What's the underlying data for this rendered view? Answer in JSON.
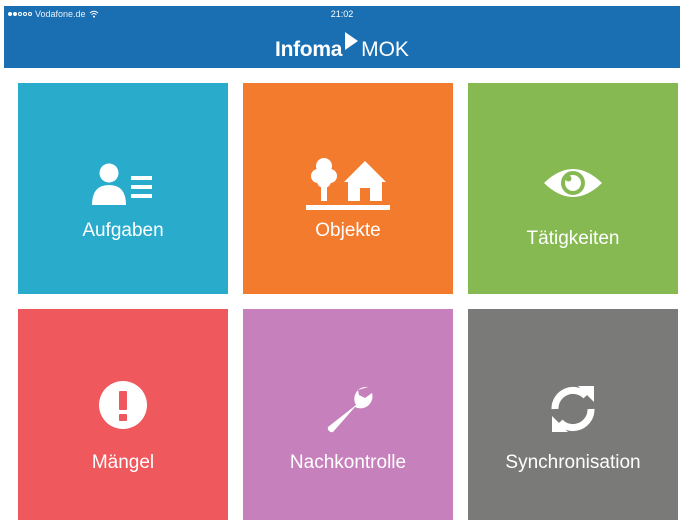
{
  "status_bar": {
    "carrier": "Vodafone.de",
    "time": "21:02"
  },
  "header": {
    "brand_name": "Infoma",
    "app_name": "MOK"
  },
  "tiles": [
    {
      "label": "Aufgaben",
      "icon": "person-list-icon",
      "color": "#29abcc"
    },
    {
      "label": "Objekte",
      "icon": "tree-house-icon",
      "color": "#f37b2e"
    },
    {
      "label": "Tätigkeiten",
      "icon": "eye-icon",
      "color": "#86b952"
    },
    {
      "label": "Mängel",
      "icon": "exclamation-circle-icon",
      "color": "#ef585c"
    },
    {
      "label": "Nachkontrolle",
      "icon": "wrench-icon",
      "color": "#c681bc"
    },
    {
      "label": "Synchronisation",
      "icon": "sync-icon",
      "color": "#7a7a78"
    }
  ]
}
